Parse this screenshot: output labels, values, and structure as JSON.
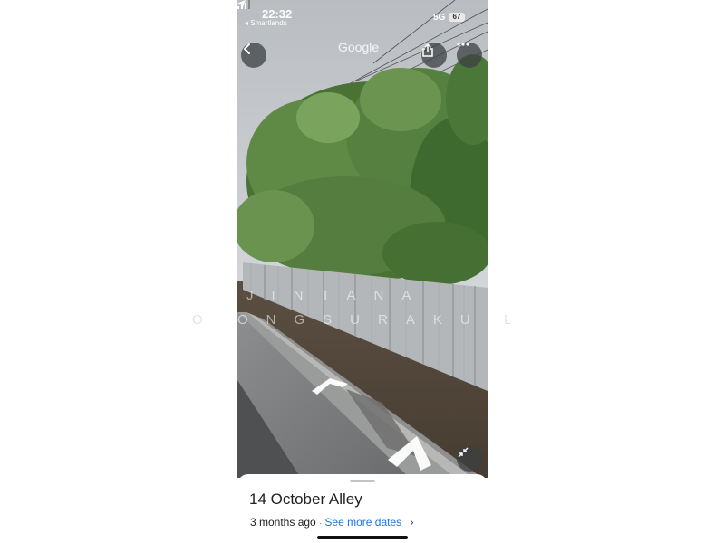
{
  "status_bar": {
    "time": "22:32",
    "back_app": "◂ Smartlands",
    "network": "5G",
    "battery": "67"
  },
  "header": {
    "brand": "Google"
  },
  "watermark": {
    "line1": "JINTANA",
    "line2": "ONGSURAKUL",
    "line1_left_glyphs": "",
    "line2_left_glyphs": "O",
    "line2_right_glyphs": "L"
  },
  "place": {
    "title": "14 October Alley",
    "age": "3 months ago",
    "separator": "·",
    "see_more_label": "See more dates",
    "chevron": "›"
  },
  "icons": {
    "back": "chevron-left-icon",
    "share": "share-icon",
    "more": "more-horizontal-icon",
    "collapse": "collapse-icon",
    "location": "location-arrow-icon",
    "signal": "cellular-signal-icon"
  },
  "colors": {
    "link": "#1a73e8",
    "sky": "#d7dadd",
    "foliage": "#4f7a3a",
    "fence": "#a8acae",
    "road": "#6d6f70",
    "button_bg": "#3c4043"
  }
}
